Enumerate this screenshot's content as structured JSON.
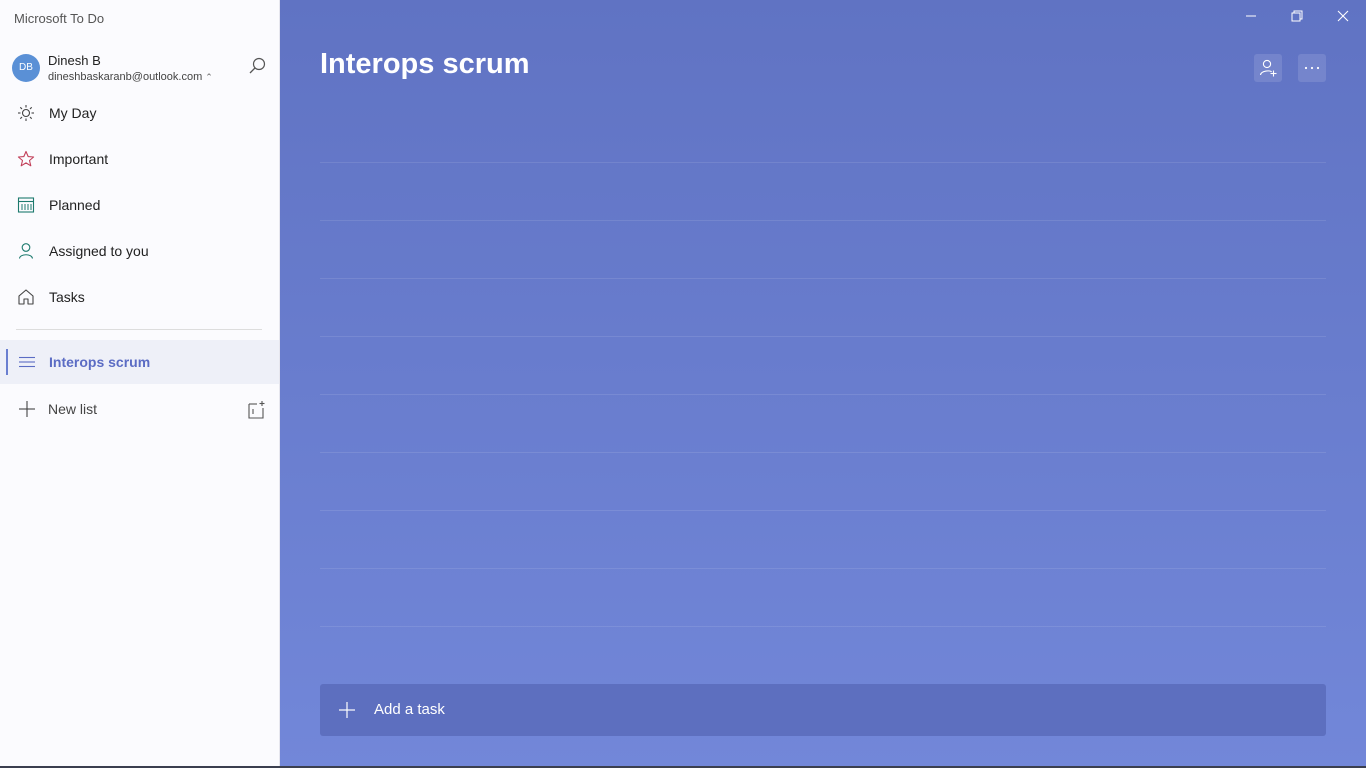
{
  "app": {
    "title": "Microsoft To Do"
  },
  "account": {
    "initials": "DB",
    "name": "Dinesh B",
    "email": "dineshbaskaranb@outlook.com"
  },
  "nav": {
    "items": [
      {
        "label": "My Day",
        "icon": "sun-icon"
      },
      {
        "label": "Important",
        "icon": "star-icon"
      },
      {
        "label": "Planned",
        "icon": "calendar-icon"
      },
      {
        "label": "Assigned to you",
        "icon": "person-icon"
      },
      {
        "label": "Tasks",
        "icon": "home-icon"
      }
    ]
  },
  "lists": {
    "selected": {
      "label": "Interops scrum",
      "icon": "list-icon"
    },
    "new_list_label": "New list"
  },
  "main": {
    "title": "Interops scrum",
    "add_task_label": "Add a task"
  },
  "colors": {
    "accent": "#5b6cc4",
    "background_top": "#6073c3",
    "background_bottom": "#7287d9",
    "important": "#c2405a",
    "planned": "#1d7a6e",
    "assigned": "#1d7a6e"
  }
}
